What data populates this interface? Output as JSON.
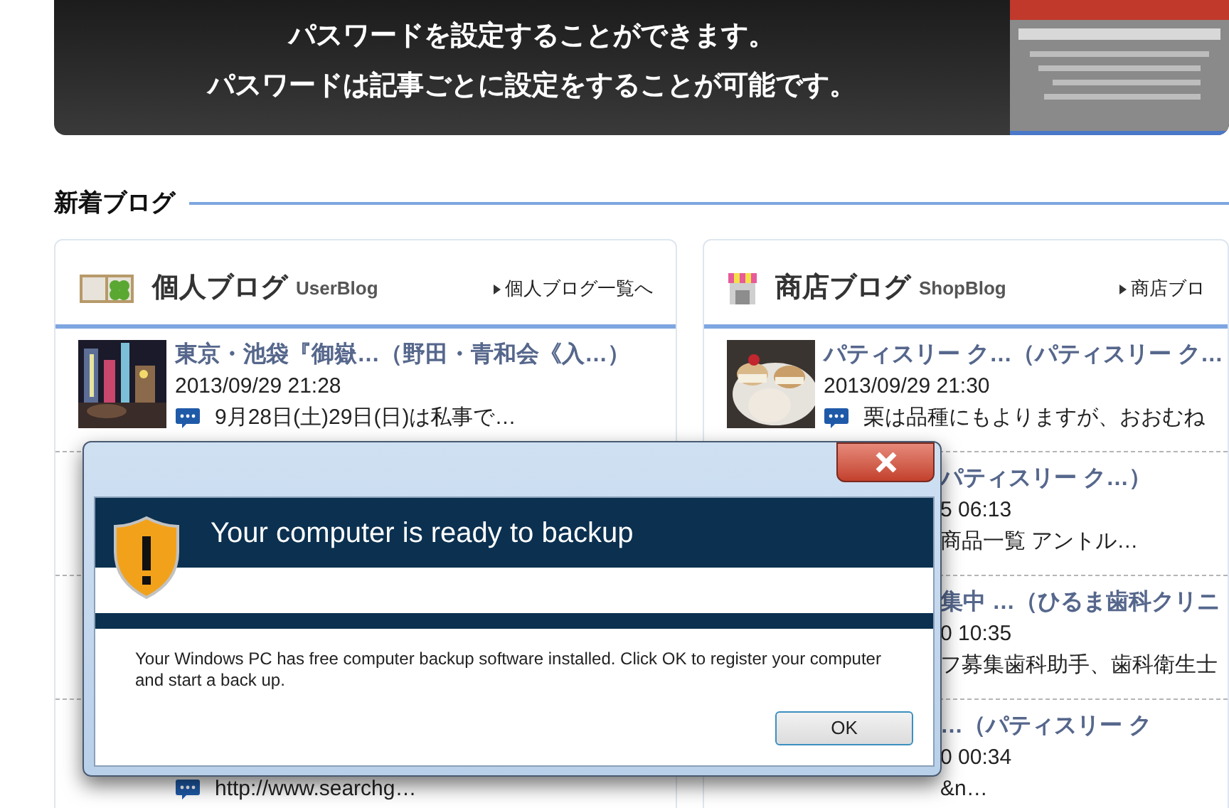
{
  "banner": {
    "lines": [
      "パスワードを設定することができます。",
      "パスワードは記事ごとに設定をすることが可能です。"
    ]
  },
  "section": {
    "title": "新着ブログ"
  },
  "cards": [
    {
      "title": "個人ブログ",
      "subtitle": "UserBlog",
      "link": "個人ブログ一覧へ",
      "rows": [
        {
          "kind": "full",
          "title": "東京・池袋『御嶽…（野田・青和会《入…）",
          "date": "2013/09/29 21:28",
          "desc": "9月28日(土)29日(日)は私事で…"
        },
        {
          "kind": "hidden"
        },
        {
          "kind": "hidden"
        },
        {
          "kind": "covered",
          "desc": "http://www.searchg…"
        }
      ]
    },
    {
      "title": "商店ブログ",
      "subtitle": "ShopBlog",
      "link": "商店ブロ",
      "rows": [
        {
          "kind": "full",
          "title": "パティスリー ク…（パティスリー ク…",
          "date": "2013/09/29 21:30",
          "desc": "栗は品種にもよりますが、おおむね"
        },
        {
          "kind": "covered",
          "title": "パティスリー ク…）",
          "date": "5 06:13",
          "desc": "商品一覧 アントル…"
        },
        {
          "kind": "covered",
          "title": "集中 …（ひるま歯科クリニ",
          "date": "0 10:35",
          "desc": "フ募集歯科助手、歯科衛生士"
        },
        {
          "kind": "covered",
          "title": "…（パティスリー ク",
          "date": "0 00:34",
          "desc": "&n…"
        }
      ]
    }
  ],
  "dialog": {
    "title": "Your computer is ready to backup",
    "message": "Your Windows PC has free computer backup software installed. Click OK to register your computer and start a back up.",
    "button": "OK"
  }
}
